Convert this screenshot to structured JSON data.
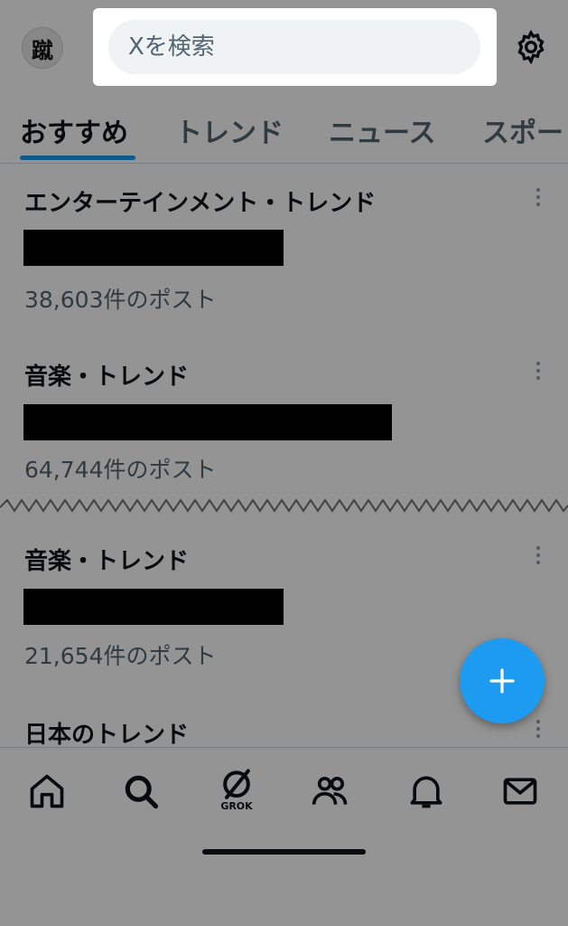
{
  "header": {
    "avatar_text": "蹴",
    "search_placeholder": "Xを検索",
    "settings_icon": "gear-icon"
  },
  "tabs": [
    {
      "label": "おすすめ",
      "active": true
    },
    {
      "label": "トレンド",
      "active": false
    },
    {
      "label": "ニュース",
      "active": false
    },
    {
      "label": "スポー",
      "active": false
    }
  ],
  "trends": [
    {
      "category": "エンターテインメント・トレンド",
      "count": "38,603件のポスト"
    },
    {
      "category": "音楽・トレンド",
      "count": "64,744件のポスト"
    },
    {
      "category": "音楽・トレンド",
      "count": "21,654件のポスト"
    },
    {
      "category": "日本のトレンド",
      "count": ""
    }
  ],
  "fab": {
    "icon": "plus-icon"
  },
  "bottom_nav": {
    "items": [
      "home-icon",
      "search-icon",
      "grok-icon",
      "communities-icon",
      "notifications-icon",
      "messages-icon"
    ],
    "grok_label": "GROK"
  },
  "colors": {
    "accent": "#1d9bf0",
    "text_primary": "#0f1419",
    "text_secondary": "#536471",
    "search_bg": "#eff3f4"
  }
}
